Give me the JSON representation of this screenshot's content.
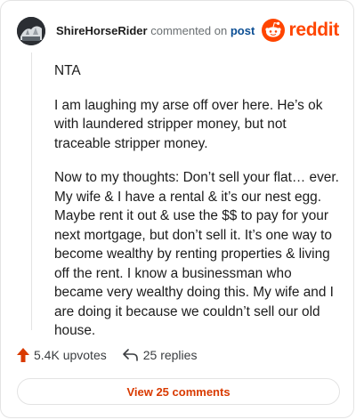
{
  "header": {
    "username": "ShireHorseRider",
    "action_text": "commented on",
    "post_link": "post",
    "brand": "reddit"
  },
  "comment": {
    "paragraphs": [
      "NTA",
      "I am laughing my arse off over here. He’s ok with laundered stripper money, but not traceable stripper money.",
      "Now to my thoughts: Don’t sell your flat… ever. My wife & I have a rental & it’s our nest egg. Maybe rent it out & use the $$ to pay for your next mortgage, but don’t sell it. It’s one way to become wealthy by renting properties & living off the rent. I know a businessman who became very wealthy doing this. My wife and I are doing it because we couldn’t sell our old house."
    ]
  },
  "stats": {
    "upvotes": "5.4K upvotes",
    "replies": "25 replies"
  },
  "footer": {
    "view_button": "View 25 comments"
  },
  "colors": {
    "brand": "#ff4500",
    "upvote": "#d93a00",
    "link": "#0b4e94"
  },
  "icons": {
    "upvote": "upvote-arrow-icon",
    "reply": "reply-arrow-icon",
    "logo": "reddit-snoo-icon"
  }
}
